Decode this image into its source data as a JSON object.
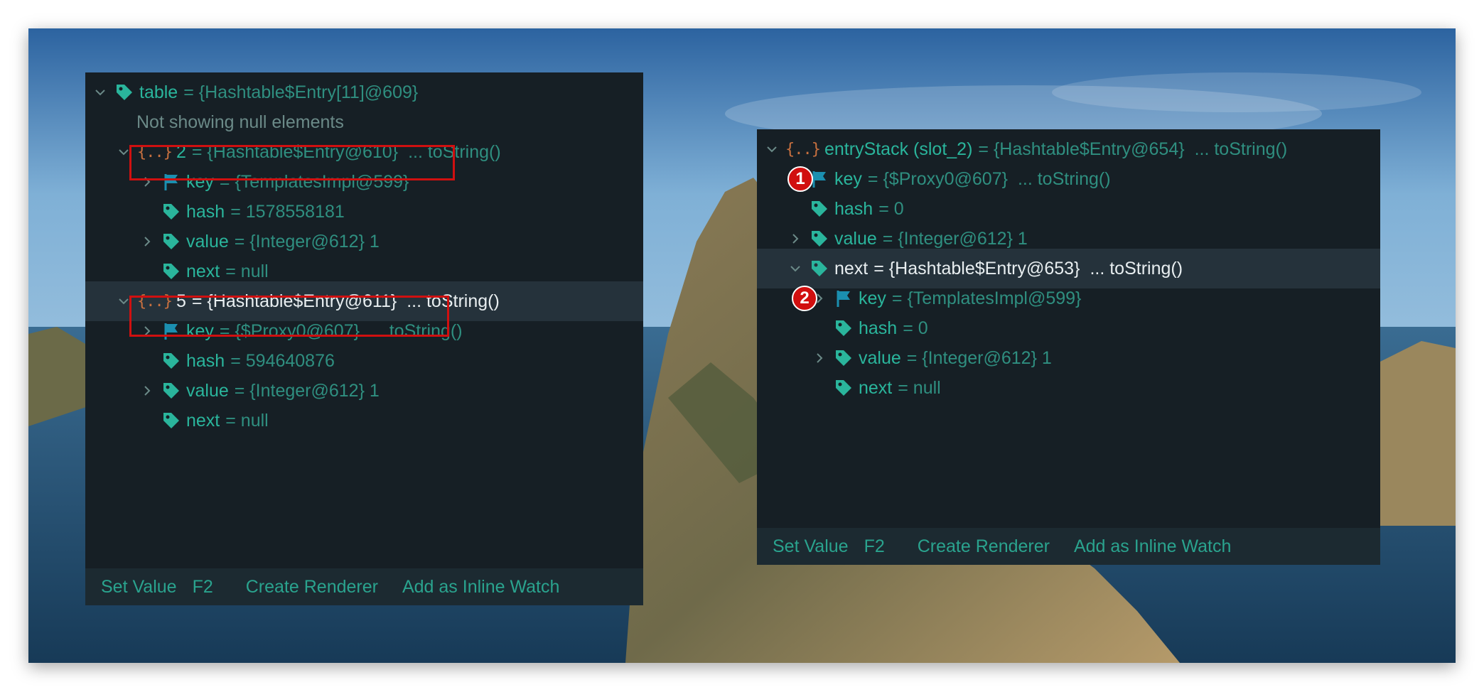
{
  "left_panel": {
    "root": {
      "name": "table",
      "value": "= {Hashtable$Entry[11]@609}"
    },
    "notice": "Not showing null elements",
    "entries": [
      {
        "name": "2",
        "value": "= {Hashtable$Entry@610}",
        "hint": "... toString()",
        "children": [
          {
            "name": "key",
            "value": "= {TemplatesImpl@599}"
          },
          {
            "name": "hash",
            "value": "= 1578558181"
          },
          {
            "name": "value",
            "value": "= {Integer@612} 1"
          },
          {
            "name": "next",
            "value": "= null"
          }
        ]
      },
      {
        "name": "5",
        "value": "= {Hashtable$Entry@611}",
        "hint": "... toString()",
        "children": [
          {
            "name": "key",
            "value": "= {$Proxy0@607}",
            "hint": "... toString()"
          },
          {
            "name": "hash",
            "value": "= 594640876"
          },
          {
            "name": "value",
            "value": "= {Integer@612} 1"
          },
          {
            "name": "next",
            "value": "= null"
          }
        ]
      }
    ],
    "footer": {
      "set_value": "Set Value",
      "shortcut": "F2",
      "create_renderer": "Create Renderer",
      "add_watch": "Add as Inline Watch"
    }
  },
  "right_panel": {
    "root": {
      "name": "entryStack (slot_2)",
      "value": "= {Hashtable$Entry@654}",
      "hint": "... toString()"
    },
    "rows": [
      {
        "name": "key",
        "value": "= {$Proxy0@607}",
        "hint": "... toString()"
      },
      {
        "name": "hash",
        "value": "= 0"
      },
      {
        "name": "value",
        "value": "= {Integer@612} 1"
      },
      {
        "name": "next",
        "value": "= {Hashtable$Entry@653}",
        "hint": "... toString()"
      },
      {
        "name": "key",
        "value": "= {TemplatesImpl@599}"
      },
      {
        "name": "hash",
        "value": "= 0"
      },
      {
        "name": "value",
        "value": "= {Integer@612} 1"
      },
      {
        "name": "next",
        "value": "= null"
      }
    ],
    "footer": {
      "set_value": "Set Value",
      "shortcut": "F2",
      "create_renderer": "Create Renderer",
      "add_watch": "Add as Inline Watch"
    }
  },
  "badges": [
    "1",
    "2"
  ],
  "icons": {
    "object": "{..}",
    "tag": "tag-icon",
    "flag": "flag-icon",
    "expand": "chevron-down-icon",
    "collapse": "chevron-right-icon"
  },
  "colors": {
    "panel_bg": "#161f25",
    "teal": "#2ab59c",
    "selected_row": "#25323b",
    "annotation_red": "#d01010"
  }
}
